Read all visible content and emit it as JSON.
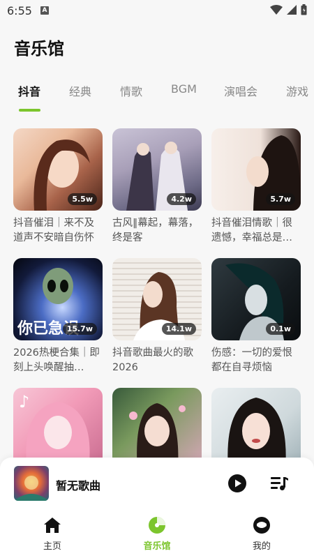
{
  "status_bar": {
    "time": "6:55",
    "notification_icon": "A"
  },
  "page": {
    "title": "音乐馆"
  },
  "tabs": [
    {
      "label": "抖音",
      "active": true
    },
    {
      "label": "经典"
    },
    {
      "label": "情歌"
    },
    {
      "label": "BGM"
    },
    {
      "label": "演唱会"
    },
    {
      "label": "游戏"
    }
  ],
  "playlists": [
    {
      "title": "抖音催泪｜来不及道声不安暗自伤怀",
      "plays": "5.5w"
    },
    {
      "title": "古风‖幕起，幕落，终是客",
      "plays": "4.2w"
    },
    {
      "title": "抖音催泪情歌｜很遗憾，幸福总是…",
      "plays": "5.7w"
    },
    {
      "title": "2026热梗合集｜即刻上头唤醒抽…",
      "plays": "15.7w"
    },
    {
      "title": "抖音歌曲最火的歌2026",
      "plays": "14.1w"
    },
    {
      "title": "伤感：一切的爱恨 都在自寻烦恼",
      "plays": "0.1w"
    },
    {
      "title": "",
      "plays": ""
    },
    {
      "title": "",
      "plays": ""
    },
    {
      "title": "",
      "plays": ""
    }
  ],
  "player": {
    "song": "暂无歌曲"
  },
  "nav": [
    {
      "label": "主页",
      "icon": "home-icon"
    },
    {
      "label": "音乐馆",
      "icon": "music-hall-icon",
      "active": true
    },
    {
      "label": "我的",
      "icon": "profile-icon"
    }
  ],
  "colors": {
    "accent": "#7cc52d",
    "background": "#f7f7f7"
  }
}
